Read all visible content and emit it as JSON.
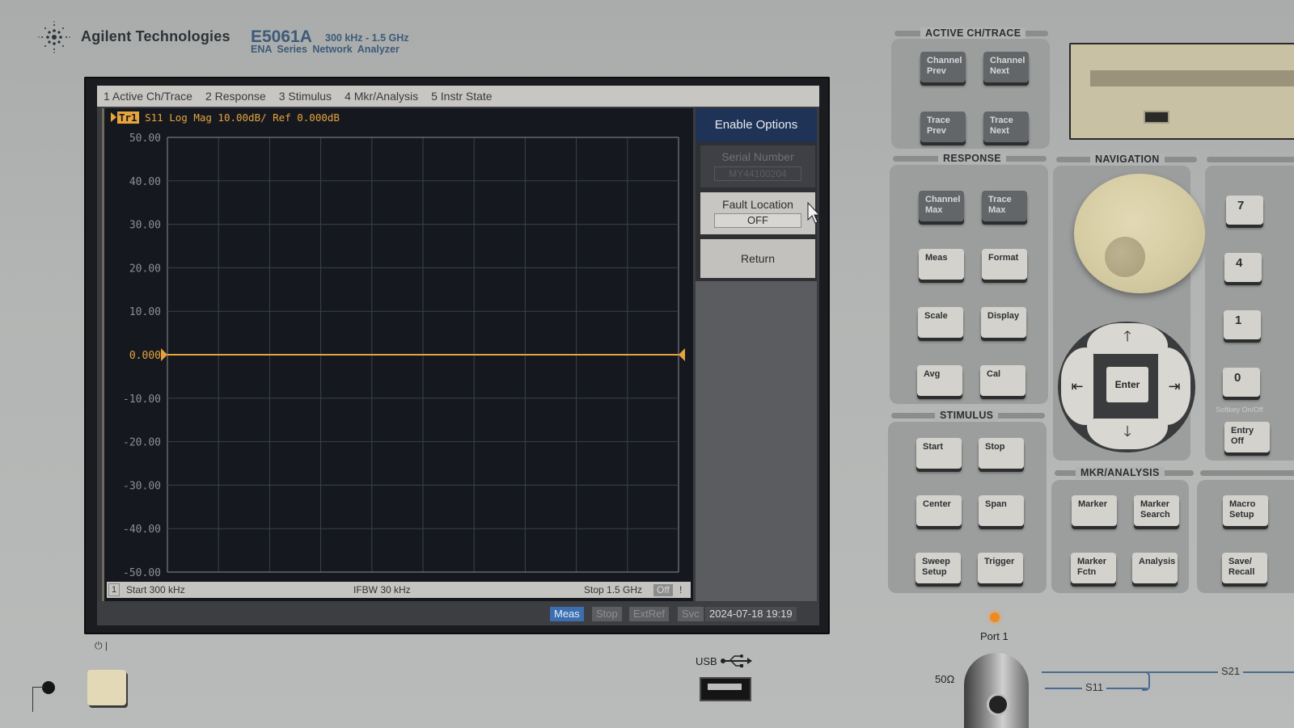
{
  "brand": {
    "company": "Agilent Technologies",
    "model": "E5061A",
    "freq_range": "300 kHz - 1.5 GHz",
    "series": "ENA Series Network Analyzer"
  },
  "screen": {
    "menu": [
      "1 Active Ch/Trace",
      "2 Response",
      "3 Stimulus",
      "4 Mkr/Analysis",
      "5 Instr State"
    ],
    "trace_header": {
      "trace_badge": "Tr1",
      "text": "S11 Log Mag 10.00dB/ Ref 0.000dB"
    },
    "softkeys": {
      "title": "Enable Options",
      "serial_label": "Serial Number",
      "serial_value": "MY44100204",
      "fault_label": "Fault Location",
      "fault_value": "OFF",
      "return_label": "Return"
    },
    "footer": {
      "channel": "1",
      "start": "Start 300 kHz",
      "ifbw": "IFBW 30 kHz",
      "stop": "Stop 1.5 GHz",
      "off_badge": "Off",
      "warning": "!"
    },
    "status": {
      "meas": "Meas",
      "stop": "Stop",
      "extref": "ExtRef",
      "svc": "Svc",
      "datetime": "2024-07-18 19:19"
    }
  },
  "chart_data": {
    "type": "line",
    "title": "S11 Log Mag 10.00dB/ Ref 0.000dB",
    "xlabel": "",
    "ylabel": "dB",
    "x_range": [
      "300 kHz",
      "1.5 GHz"
    ],
    "x_divisions": 10,
    "ylim": [
      -50,
      50
    ],
    "y_ticks": [
      50,
      40,
      30,
      20,
      10,
      0,
      -10,
      -20,
      -30,
      -40,
      -50
    ],
    "y_tick_labels": [
      "50.00",
      "40.00",
      "30.00",
      "20.00",
      "10.00",
      "0.000",
      "-10.00",
      "-20.00",
      "-30.00",
      "-40.00",
      "-50.00"
    ],
    "reference_value": 0,
    "grid": true,
    "series": [
      {
        "name": "Tr1 S11",
        "color": "#e7a33c",
        "x": [
          0,
          0.1,
          0.2,
          0.3,
          0.4,
          0.5,
          0.6,
          0.7,
          0.8,
          0.9,
          1.0
        ],
        "values": [
          0,
          0,
          0,
          0,
          0,
          0,
          0,
          0,
          0,
          0,
          0
        ]
      }
    ]
  },
  "panel": {
    "active_ch_trace": {
      "label": "ACTIVE CH/TRACE",
      "keys": [
        "Channel\nPrev",
        "Channel\nNext",
        "Trace\nPrev",
        "Trace\nNext"
      ]
    },
    "response": {
      "label": "RESPONSE",
      "keys": [
        "Channel\nMax",
        "Trace\nMax",
        "Meas",
        "Format",
        "Scale",
        "Display",
        "Avg",
        "Cal"
      ]
    },
    "stimulus": {
      "label": "STIMULUS",
      "keys": [
        "Start",
        "Stop",
        "Center",
        "Span",
        "Sweep\nSetup",
        "Trigger"
      ]
    },
    "navigation": {
      "label": "NAVIGATION",
      "enter": "Enter",
      "up": "🡑",
      "down": "🡓",
      "left": "⇤",
      "right": "⇥"
    },
    "mkr_analysis": {
      "label": "MKR/ANALYSIS",
      "keys": [
        "Marker",
        "Marker\nSearch",
        "Marker\nFctn",
        "Analysis"
      ]
    },
    "instr_state": {
      "keys": [
        "Macro\nSetup",
        "Save/\nRecall"
      ]
    },
    "numeric": {
      "keys": [
        "7",
        "4",
        "1",
        "0"
      ],
      "softkey_onoff": "Softkey On/Off",
      "entry_off": "Entry\nOff"
    },
    "power": {
      "symbols": "⏻ |"
    },
    "usb": {
      "label": "USB"
    },
    "port": {
      "label": "Port 1",
      "impedance": "50Ω",
      "s11": "S11",
      "s21": "S21"
    }
  },
  "colors": {
    "trace": "#e7a33c",
    "grid": "#3b4149",
    "softkey_title": "#1e3356",
    "meas_badge": "#3c6fb0"
  }
}
